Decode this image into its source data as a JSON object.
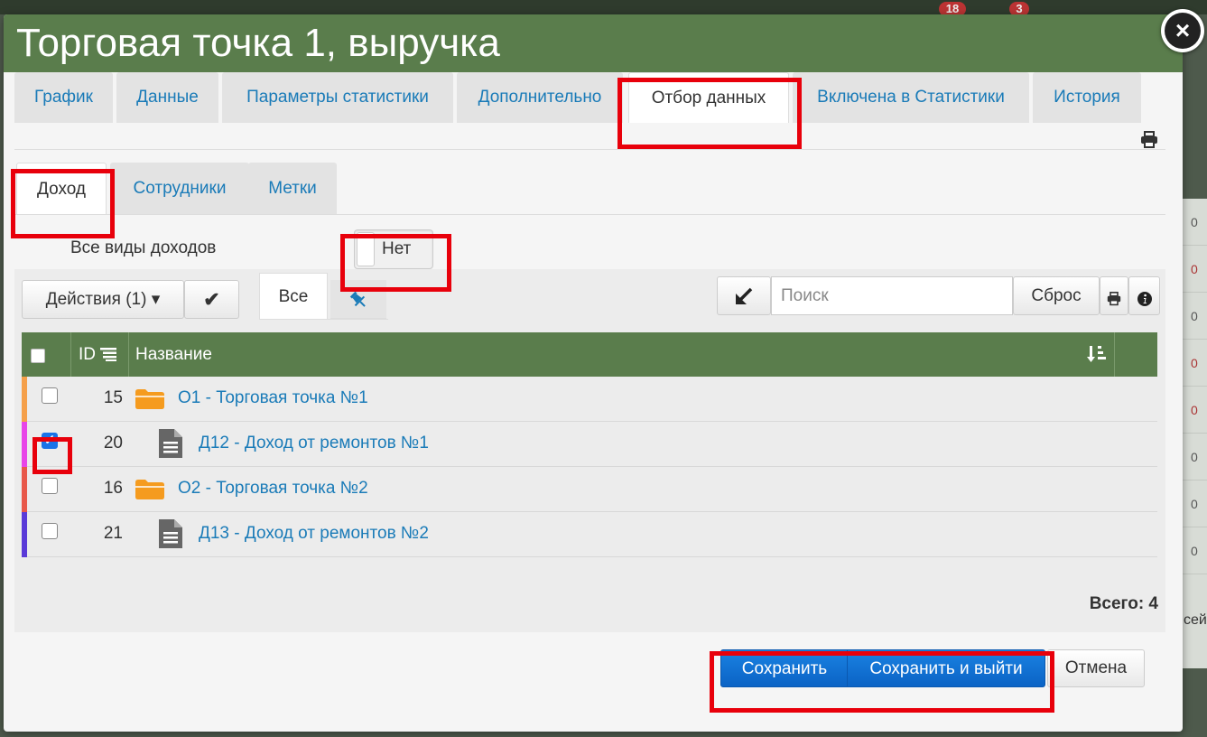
{
  "background": {
    "badges": [
      "18",
      "3"
    ],
    "side_values": [
      "0",
      "0",
      "0",
      "0",
      "0",
      "0",
      "0",
      "0"
    ],
    "side_tail": "сей"
  },
  "modal": {
    "title": "Торговая точка 1, выручка",
    "close_glyph": "×"
  },
  "main_tabs": [
    {
      "label": "График",
      "active": false
    },
    {
      "label": "Данные",
      "active": false
    },
    {
      "label": "Параметры статистики",
      "active": false
    },
    {
      "label": "Дополнительно",
      "active": false
    },
    {
      "label": "Отбор данных",
      "active": true
    },
    {
      "label": "Включена в Статистики",
      "active": false
    },
    {
      "label": "История",
      "active": false
    }
  ],
  "sub_tabs": [
    {
      "label": "Доход",
      "active": true
    },
    {
      "label": "Сотрудники",
      "active": false
    },
    {
      "label": "Метки",
      "active": false
    }
  ],
  "filter": {
    "label": "Все виды доходов",
    "toggle_value": "Нет"
  },
  "toolbar": {
    "actions_label": "Действия (1)",
    "actions_caret": "▾",
    "check_glyph": "✔",
    "segment_all": "Все",
    "pin_glyph": "📌",
    "search_placeholder": "Поиск",
    "reset_label": "Сброс"
  },
  "table": {
    "columns": {
      "id": "ID",
      "name": "Название"
    },
    "rows": [
      {
        "id": "15",
        "name": "О1 - Торговая точка №1",
        "type": "folder-icon",
        "checked": false,
        "color": "#f5a04a"
      },
      {
        "id": "20",
        "name": "Д12 - Доход от ремонтов №1",
        "type": "document-icon",
        "checked": true,
        "color": "#e845e8"
      },
      {
        "id": "16",
        "name": "О2 - Торговая точка №2",
        "type": "folder-icon",
        "checked": false,
        "color": "#e8584a"
      },
      {
        "id": "21",
        "name": "Д13 - Доход от ремонтов №2",
        "type": "document-icon",
        "checked": false,
        "color": "#5a3ad8"
      }
    ],
    "total_label": "Всего: 4"
  },
  "footer": {
    "save_label": "Сохранить",
    "save_exit_label": "Сохранить и выйти",
    "cancel_label": "Отмена"
  },
  "colors": {
    "header_green": "#5a7d4c",
    "link_blue": "#1a7bb8",
    "primary_blue": "#0b63c5",
    "highlight_red": "#e8000b"
  }
}
